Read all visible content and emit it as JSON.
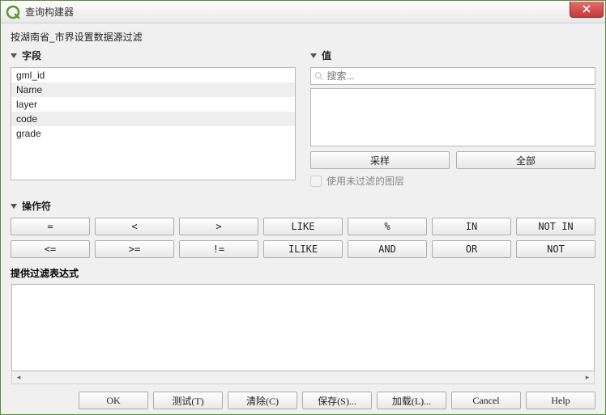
{
  "window": {
    "title": "查询构建器"
  },
  "subtitle": "按湖南省_市界设置数据源过滤",
  "fields": {
    "header": "字段",
    "items": [
      "gml_id",
      "Name",
      "layer",
      "code",
      "grade"
    ]
  },
  "values": {
    "header": "值",
    "search_placeholder": "搜索...",
    "sample_btn": "采样",
    "all_btn": "全部",
    "use_unfiltered": "使用未过滤的图层"
  },
  "operators": {
    "header": "操作符",
    "row1": [
      "=",
      "<",
      ">",
      "LIKE",
      "%",
      "IN",
      "NOT IN"
    ],
    "row2": [
      "<=",
      ">=",
      "!=",
      "ILIKE",
      "AND",
      "OR",
      "NOT"
    ]
  },
  "expr": {
    "header": "提供过滤表达式",
    "value": ""
  },
  "footer": {
    "ok": "OK",
    "test": "测试(T)",
    "clear": "清除(C)",
    "save": "保存(S)...",
    "load": "加载(L)...",
    "cancel": "Cancel",
    "help": "Help"
  }
}
